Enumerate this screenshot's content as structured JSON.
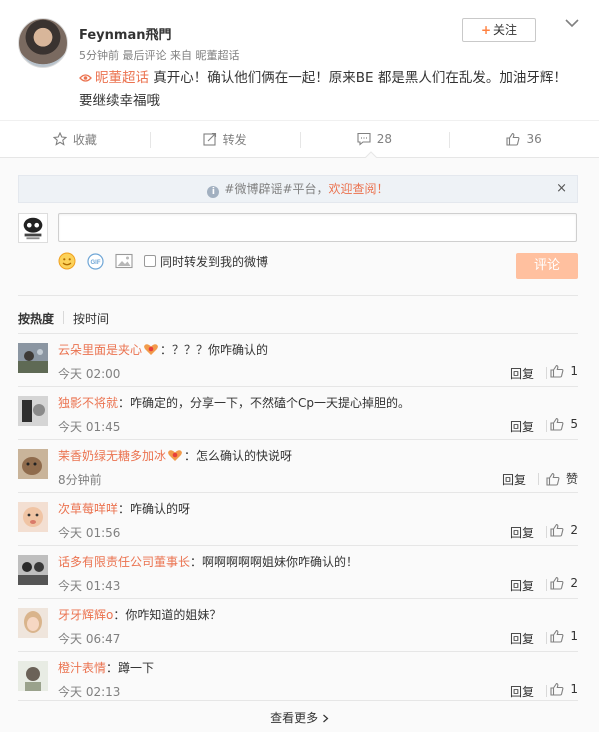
{
  "post": {
    "username": "Feynman飛門",
    "time": "5分钟前",
    "last_comment": "最后评论",
    "source_prefix": "来自",
    "source": "昵董超话",
    "follow_label": "关注",
    "follow_plus": "+",
    "topic": "昵董超话",
    "text": " 真开心！确认他们俩在一起！原来BE 都是黑人们在乱发。加油牙辉！要继续幸福哦"
  },
  "actions": {
    "favorite": "收藏",
    "repost": "转发",
    "comment_count": "28",
    "like_count": "36"
  },
  "notice": {
    "prefix": "#微博辟谣#平台，",
    "highlight": "欢迎查阅！",
    "close": "×",
    "info": "i"
  },
  "composer": {
    "input_value": "",
    "repost_label": "同时转发到我的微博",
    "submit_label": "评论"
  },
  "sort": {
    "hot": "按热度",
    "time": "按时间"
  },
  "comments": [
    {
      "nick": "云朵里面是夹心",
      "badge": true,
      "text": "：？？？你咋确认的",
      "time": "今天 02:00",
      "reply": "回复",
      "likes": "1"
    },
    {
      "nick": "独影不将就",
      "badge": false,
      "text": "：咋确定的，分享一下，不然磕个Cp一天提心掉胆的。",
      "time": "今天 01:45",
      "reply": "回复",
      "likes": "5"
    },
    {
      "nick": "茉香奶绿无糖多加冰",
      "badge": true,
      "text": "：怎么确认的快说呀",
      "time": "8分钟前",
      "reply": "回复",
      "likes": "赞"
    },
    {
      "nick": "次草莓咩咩",
      "badge": false,
      "text": "：咋确认的呀",
      "time": "今天 01:56",
      "reply": "回复",
      "likes": "2"
    },
    {
      "nick": "话多有限责任公司董事长",
      "badge": false,
      "text": "：啊啊啊啊啊姐妹你咋确认的！",
      "time": "今天 01:43",
      "reply": "回复",
      "likes": "2"
    },
    {
      "nick": "牙牙辉辉o",
      "badge": false,
      "text": "：你咋知道的姐妹？",
      "time": "今天 06:47",
      "reply": "回复",
      "likes": "1"
    },
    {
      "nick": "橙汁表情",
      "badge": false,
      "text": "：蹲一下",
      "time": "今天 02:13",
      "reply": "回复",
      "likes": "1"
    }
  ],
  "more_label": "查看更多",
  "colors": {
    "accent": "#eb7350",
    "follow_plus": "#ff8140",
    "submit_bg": "#ffc09f",
    "notice_bg": "#eef2f6"
  }
}
